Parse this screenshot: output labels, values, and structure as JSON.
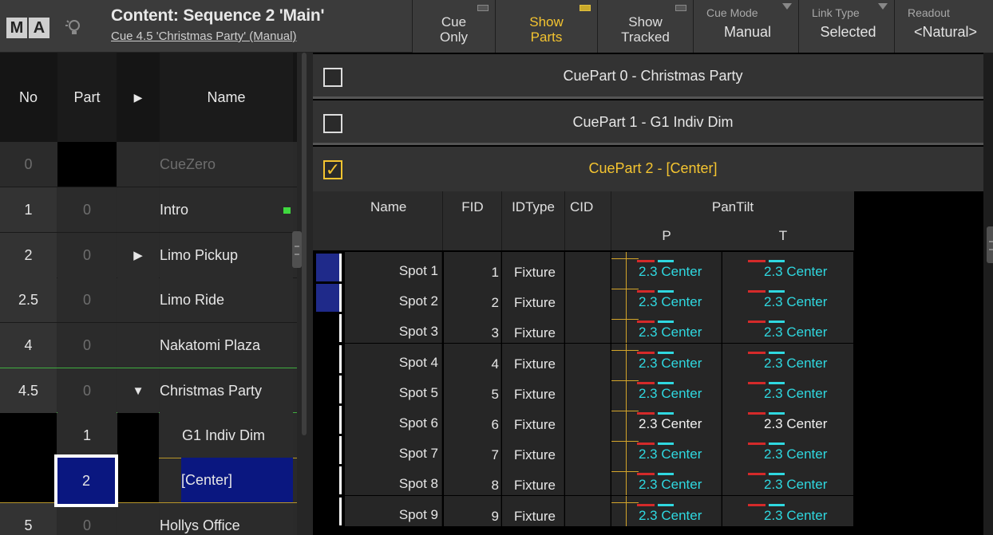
{
  "header": {
    "logo": [
      "M",
      "A"
    ],
    "title": "Content: Sequence 2 'Main'",
    "subtitle": "Cue 4.5 'Christmas Party' (Manual)"
  },
  "toolbar": {
    "cue_only": [
      "Cue",
      "Only"
    ],
    "show_parts": [
      "Show",
      "Parts"
    ],
    "show_tracked": [
      "Show",
      "Tracked"
    ],
    "cue_mode": {
      "label": "Cue Mode",
      "value": "Manual"
    },
    "link_type": {
      "label": "Link Type",
      "value": "Selected"
    },
    "readout": {
      "label": "Readout",
      "value": "<Natural>"
    }
  },
  "cuelist": {
    "headers": {
      "no": "No",
      "part": "Part",
      "arrow": "▶",
      "name": "Name"
    },
    "rows": [
      {
        "no": "0",
        "part": "",
        "arrow": "",
        "name": "CueZero",
        "state": "zero"
      },
      {
        "no": "1",
        "part": "0",
        "arrow": "",
        "name": "Intro",
        "state": "normal"
      },
      {
        "no": "2",
        "part": "0",
        "arrow": "▶",
        "name": "Limo Pickup",
        "state": "normal"
      },
      {
        "no": "2.5",
        "part": "0",
        "arrow": "",
        "name": "Limo Ride",
        "state": "normal"
      },
      {
        "no": "4",
        "part": "0",
        "arrow": "",
        "name": "Nakatomi Plaza",
        "state": "normal"
      },
      {
        "no": "4.5",
        "part": "0",
        "arrow": "▼",
        "name": "Christmas Party",
        "state": "current"
      },
      {
        "no": "",
        "part": "1",
        "arrow": "",
        "name": "G1 Indiv Dim",
        "state": "part"
      },
      {
        "no": "",
        "part": "2",
        "arrow": "",
        "name": "[Center]",
        "state": "selected"
      },
      {
        "no": "5",
        "part": "0",
        "arrow": "",
        "name": "Hollys Office",
        "state": "normal"
      }
    ]
  },
  "cueparts": [
    {
      "label": "CuePart 0 - Christmas Party",
      "checked": false
    },
    {
      "label": "CuePart 1 - G1 Indiv Dim",
      "checked": false
    },
    {
      "label": "CuePart 2 - [Center]",
      "checked": true
    }
  ],
  "grid": {
    "headers": {
      "name": "Name",
      "fid": "FID",
      "idtype": "IDType",
      "cid": "CID",
      "pantilt": "PanTilt",
      "p": "P",
      "t": "T"
    },
    "rows": [
      {
        "name": "Spot 1",
        "fid": "1",
        "type": "Fixture",
        "p": "2.3  Center",
        "t": "2.3  Center",
        "color": "#1f2a8a",
        "white": false
      },
      {
        "name": "Spot 2",
        "fid": "2",
        "type": "Fixture",
        "p": "2.3  Center",
        "t": "2.3  Center",
        "color": "#1f2a8a",
        "white": false
      },
      {
        "name": "Spot 3",
        "fid": "3",
        "type": "Fixture",
        "p": "2.3  Center",
        "t": "2.3  Center",
        "color": "#000000",
        "white": false
      },
      {
        "name": "Spot 4",
        "fid": "4",
        "type": "Fixture",
        "p": "2.3  Center",
        "t": "2.3  Center",
        "color": "#000000",
        "white": false
      },
      {
        "name": "Spot 5",
        "fid": "5",
        "type": "Fixture",
        "p": "2.3  Center",
        "t": "2.3  Center",
        "color": "#000000",
        "white": false
      },
      {
        "name": "Spot 6",
        "fid": "6",
        "type": "Fixture",
        "p": "2.3  Center",
        "t": "2.3  Center",
        "color": "#000000",
        "white": true
      },
      {
        "name": "Spot 7",
        "fid": "7",
        "type": "Fixture",
        "p": "2.3  Center",
        "t": "2.3  Center",
        "color": "#000000",
        "white": false
      },
      {
        "name": "Spot 8",
        "fid": "8",
        "type": "Fixture",
        "p": "2.3  Center",
        "t": "2.3  Center",
        "color": "#000000",
        "white": false
      },
      {
        "name": "Spot 9",
        "fid": "9",
        "type": "Fixture",
        "p": "2.3  Center",
        "t": "2.3  Center",
        "color": "#000000",
        "white": false
      }
    ]
  },
  "colors": {
    "accent": "#f4c430",
    "value_cyan": "#2fd8e0",
    "selected_blue": "#0a1780",
    "current_green": "#3fae3f"
  }
}
